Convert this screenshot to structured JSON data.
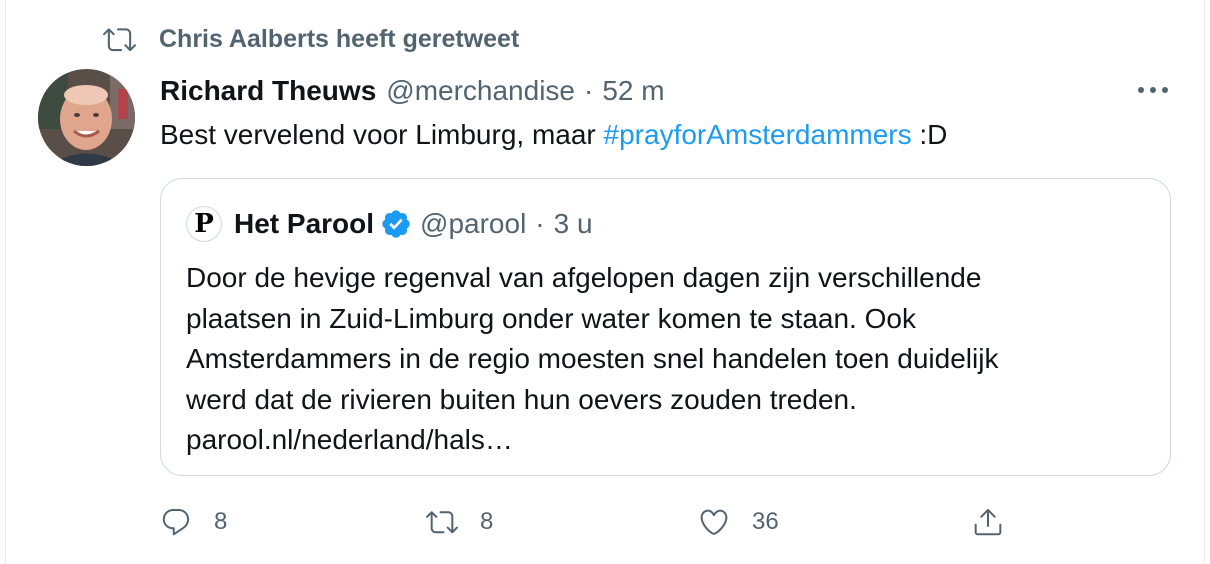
{
  "retweet_context": {
    "text": "Chris Aalberts heeft geretweet",
    "icon": "retweet-icon"
  },
  "tweet": {
    "author_name": "Richard Theuws",
    "handle": "@merchandise",
    "separator": "·",
    "time": "52 m",
    "text_before": "Best vervelend voor Limburg, maar ",
    "hashtag": "#prayforAmsterdammers",
    "text_after": " :D"
  },
  "quoted_tweet": {
    "logo_letter": "P",
    "author_name": "Het Parool",
    "handle": "@parool",
    "separator": "·",
    "time": "3 u",
    "body_lines": [
      "Door de hevige regenval van afgelopen dagen zijn verschillende",
      "plaatsen in Zuid-Limburg onder water komen te staan. Ook",
      "Amsterdammers in de regio moesten snel handelen toen duidelijk",
      "werd dat de rivieren buiten hun oevers zouden treden.",
      "parool.nl/nederland/hals…"
    ]
  },
  "actions": {
    "replies": "8",
    "retweets": "8",
    "likes": "36"
  },
  "colors": {
    "hashtag": "#1d9bf0",
    "muted": "#536471",
    "verified": "#1d9bf0",
    "border": "#cfd9de"
  }
}
